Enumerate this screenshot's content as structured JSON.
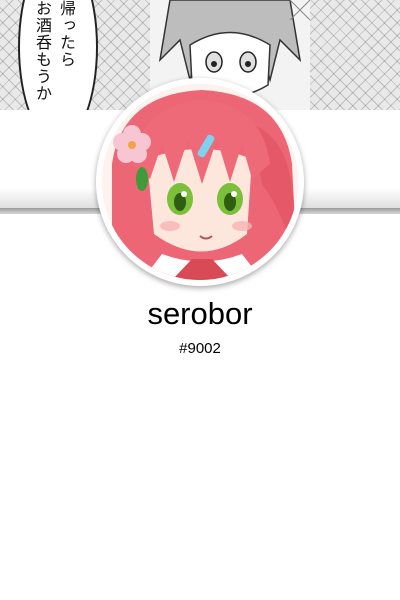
{
  "banner": {
    "speech_text": "帰ったらお酒呑もうか",
    "speech_line_1": "帰ったら",
    "speech_line_2": "お酒呑もうか"
  },
  "profile": {
    "username": "serobor",
    "discriminator": "#9002"
  },
  "colors": {
    "background": "#ffffff",
    "avatar_hair": "#ef6a78",
    "avatar_eyes": "#7bbf3a",
    "band_shadow": "#9a9a9a"
  }
}
